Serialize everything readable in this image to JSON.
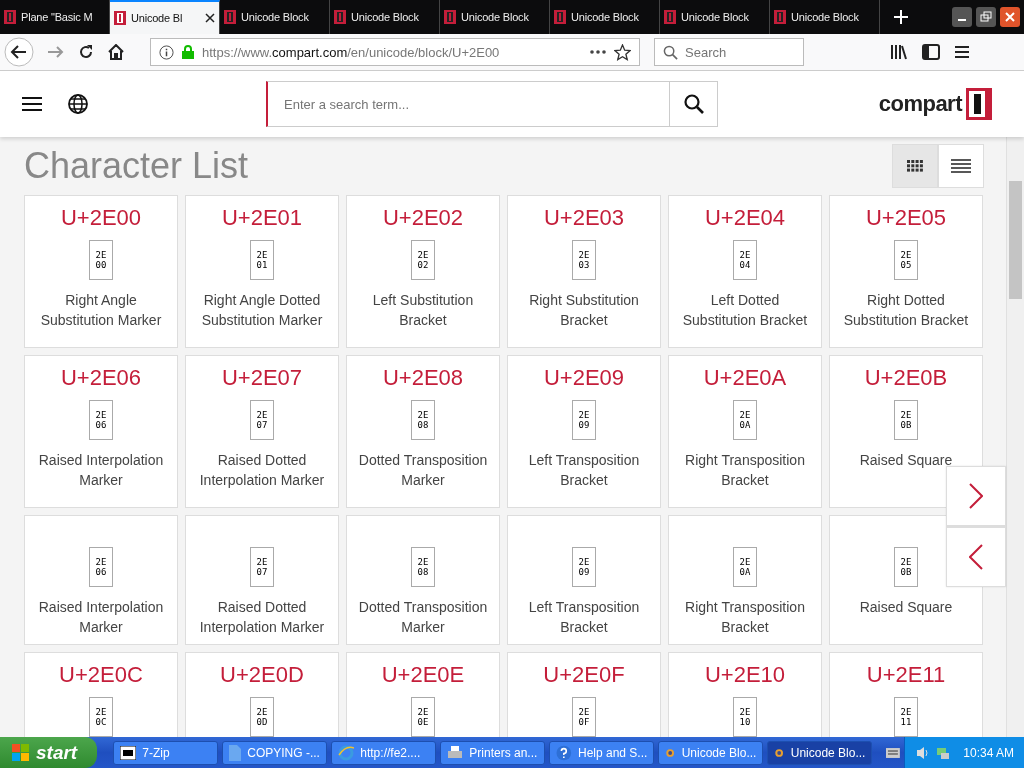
{
  "browser": {
    "tabs": [
      {
        "label": "Plane \"Basic M",
        "selected": false,
        "closable": false
      },
      {
        "label": "Unicode Bl",
        "selected": true,
        "closable": true
      },
      {
        "label": "Unicode Block",
        "selected": false,
        "closable": false
      },
      {
        "label": "Unicode Block",
        "selected": false,
        "closable": false
      },
      {
        "label": "Unicode Block",
        "selected": false,
        "closable": false
      },
      {
        "label": "Unicode Block",
        "selected": false,
        "closable": false
      },
      {
        "label": "Unicode Block",
        "selected": false,
        "closable": false
      },
      {
        "label": "Unicode Block",
        "selected": false,
        "closable": false
      }
    ],
    "url": {
      "prefix": "https://www.",
      "domain": "compart.com",
      "path": "/en/unicode/block/U+2E00"
    },
    "search_placeholder": "Search"
  },
  "site": {
    "search_placeholder": "Enter a search term...",
    "logo": "compart"
  },
  "heading": "Character List",
  "view_modes": [
    {
      "kind": "grid",
      "selected": true
    },
    {
      "kind": "list",
      "selected": false
    }
  ],
  "cards": [
    {
      "code": "U+2E00",
      "hex": [
        "2E",
        "00"
      ],
      "name": "Right Angle Substitution Marker"
    },
    {
      "code": "U+2E01",
      "hex": [
        "2E",
        "01"
      ],
      "name": "Right Angle Dotted Substitution Marker"
    },
    {
      "code": "U+2E02",
      "hex": [
        "2E",
        "02"
      ],
      "name": "Left Substitution Bracket"
    },
    {
      "code": "U+2E03",
      "hex": [
        "2E",
        "03"
      ],
      "name": "Right Substitution Bracket"
    },
    {
      "code": "U+2E04",
      "hex": [
        "2E",
        "04"
      ],
      "name": "Left Dotted Substitution Bracket"
    },
    {
      "code": "U+2E05",
      "hex": [
        "2E",
        "05"
      ],
      "name": "Right Dotted Substitution Bracket"
    },
    {
      "code": "U+2E06",
      "hex": [
        "2E",
        "06"
      ],
      "name": "Raised Interpolation Marker"
    },
    {
      "code": "U+2E07",
      "hex": [
        "2E",
        "07"
      ],
      "name": "Raised Dotted Interpolation Marker"
    },
    {
      "code": "U+2E08",
      "hex": [
        "2E",
        "08"
      ],
      "name": "Dotted Transposition Marker"
    },
    {
      "code": "U+2E09",
      "hex": [
        "2E",
        "09"
      ],
      "name": "Left Transposition Bracket"
    },
    {
      "code": "U+2E0A",
      "hex": [
        "2E",
        "0A"
      ],
      "name": "Right Transposition Bracket"
    },
    {
      "code": "U+2E0B",
      "hex": [
        "2E",
        "0B"
      ],
      "name": "Raised Square"
    },
    {
      "hex": [
        "2E",
        "06"
      ],
      "name": "Raised Interpolation Marker"
    },
    {
      "hex": [
        "2E",
        "07"
      ],
      "name": "Raised Dotted Interpolation Marker"
    },
    {
      "hex": [
        "2E",
        "08"
      ],
      "name": "Dotted Transposition Marker"
    },
    {
      "hex": [
        "2E",
        "09"
      ],
      "name": "Left Transposition Bracket"
    },
    {
      "hex": [
        "2E",
        "0A"
      ],
      "name": "Right Transposition Bracket"
    },
    {
      "hex": [
        "2E",
        "0B"
      ],
      "name": "Raised Square"
    },
    {
      "code": "U+2E0C",
      "hex": [
        "2E",
        "0C"
      ]
    },
    {
      "code": "U+2E0D",
      "hex": [
        "2E",
        "0D"
      ]
    },
    {
      "code": "U+2E0E",
      "hex": [
        "2E",
        "0E"
      ]
    },
    {
      "code": "U+2E0F",
      "hex": [
        "2E",
        "0F"
      ]
    },
    {
      "code": "U+2E10",
      "hex": [
        "2E",
        "10"
      ]
    },
    {
      "code": "U+2E11",
      "hex": [
        "2E",
        "11"
      ]
    }
  ],
  "taskbar": {
    "start": "start",
    "items": [
      {
        "label": "7-Zip",
        "kind": "archive",
        "selected": false
      },
      {
        "label": "COPYING -...",
        "kind": "document",
        "selected": false
      },
      {
        "label": "http://fe2....",
        "kind": "web",
        "selected": false
      },
      {
        "label": "Printers an...",
        "kind": "printers",
        "selected": false
      },
      {
        "label": "Help and S...",
        "kind": "help",
        "selected": false
      },
      {
        "label": "Unicode Blo...",
        "kind": "browser",
        "selected": false
      },
      {
        "label": "Unicode Blo...",
        "kind": "browser",
        "selected": true
      }
    ],
    "clock": "10:34 AM"
  }
}
